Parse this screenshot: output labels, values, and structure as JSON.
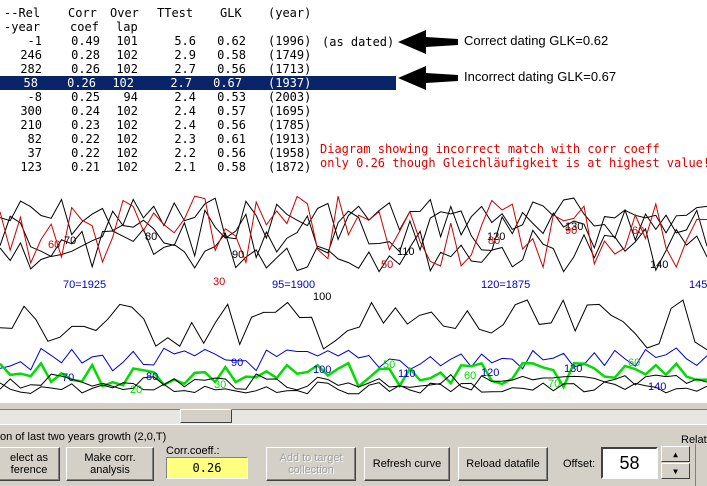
{
  "colors": {
    "selection": "#0a246a",
    "note": "#e00000",
    "corr_box": "#ffff80",
    "panel": "#d4d0c8",
    "series_red": "#cc0000",
    "series_blue": "#0000cc",
    "series_green": "#00dd00"
  },
  "table": {
    "header1": [
      "--Rel",
      "Corr",
      "Over",
      "TTest",
      "GLK",
      "(year)"
    ],
    "header2": [
      "-year",
      "coef",
      "lap",
      "",
      "",
      ""
    ],
    "rows": [
      [
        "-1",
        "0.49",
        "101",
        "5.6",
        "0.62",
        "(1996)"
      ],
      [
        "246",
        "0.28",
        "102",
        "2.9",
        "0.58",
        "(1749)"
      ],
      [
        "282",
        "0.26",
        "102",
        "2.7",
        "0.56",
        "(1713)"
      ],
      [
        "58",
        "0.26",
        "102",
        "2.7",
        "0.67",
        "(1937)"
      ],
      [
        "-8",
        "0.25",
        "94",
        "2.4",
        "0.53",
        "(2003)"
      ],
      [
        "300",
        "0.24",
        "102",
        "2.4",
        "0.57",
        "(1695)"
      ],
      [
        "210",
        "0.23",
        "102",
        "2.4",
        "0.56",
        "(1785)"
      ],
      [
        "82",
        "0.22",
        "102",
        "2.3",
        "0.61",
        "(1913)"
      ],
      [
        "37",
        "0.22",
        "102",
        "2.2",
        "0.56",
        "(1958)"
      ],
      [
        "123",
        "0.21",
        "102",
        "2.1",
        "0.58",
        "(1872)"
      ]
    ],
    "selected_row": 3,
    "dated_label": "(as dated)"
  },
  "annotations": {
    "correct": "Correct dating GLK=0.62",
    "incorrect": "Incorrect dating GLK=0.67",
    "note_line1": "Diagram showing incorrect match with corr coeff",
    "note_line2": "only 0.26 though Gleichläufigkeit is at highest value!"
  },
  "chart_labels": {
    "upper_black": [
      "70",
      "80",
      "90",
      "100",
      "110",
      "120",
      "130",
      "140"
    ],
    "upper_red": [
      "60",
      "30",
      "50",
      "80",
      "90",
      "60"
    ],
    "blue_years": [
      "70=1925",
      "95=1900",
      "120=1875",
      "145"
    ],
    "lower_blue": [
      "70",
      "80",
      "90",
      "100",
      "110",
      "120",
      "130",
      "140"
    ],
    "lower_green": [
      "20",
      "30",
      "50",
      "60",
      "70",
      "60"
    ]
  },
  "panel": {
    "title_partial": "on of last two years growth (2,0,T)",
    "select_ref": "elect as\nference",
    "make_corr": "Make corr.\nanalysis",
    "corr_label": "Corr.coeff.:",
    "corr_value": "0.26",
    "add_target": "Add to target\ncollection",
    "refresh": "Refresh curve",
    "reload": "Reload datafile",
    "offset_label": "Offset:",
    "offset_value": "58",
    "relat_partial": "Relati"
  }
}
